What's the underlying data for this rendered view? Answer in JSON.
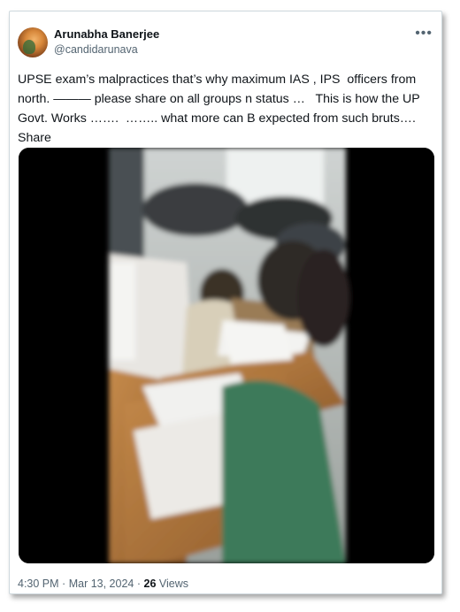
{
  "author": {
    "name": "Arunabha Banerjee",
    "handle": "@candidarunava"
  },
  "menu_icon": "more-horizontal-icon",
  "tweet": {
    "text": "UPSE exam’s malpractices that’s why maximum IAS , IPS  officers from north. ——— please share on all groups n status …   This is how the UP Govt. Works …….  …….. what more can B expected from such bruts…. Share"
  },
  "media": {
    "kind": "video-still",
    "scene": "classroom exam hall with students at desks"
  },
  "meta": {
    "time": "4:30 PM",
    "separator": "·",
    "date": "Mar 13, 2024",
    "views_count": "26",
    "views_label": "Views"
  }
}
